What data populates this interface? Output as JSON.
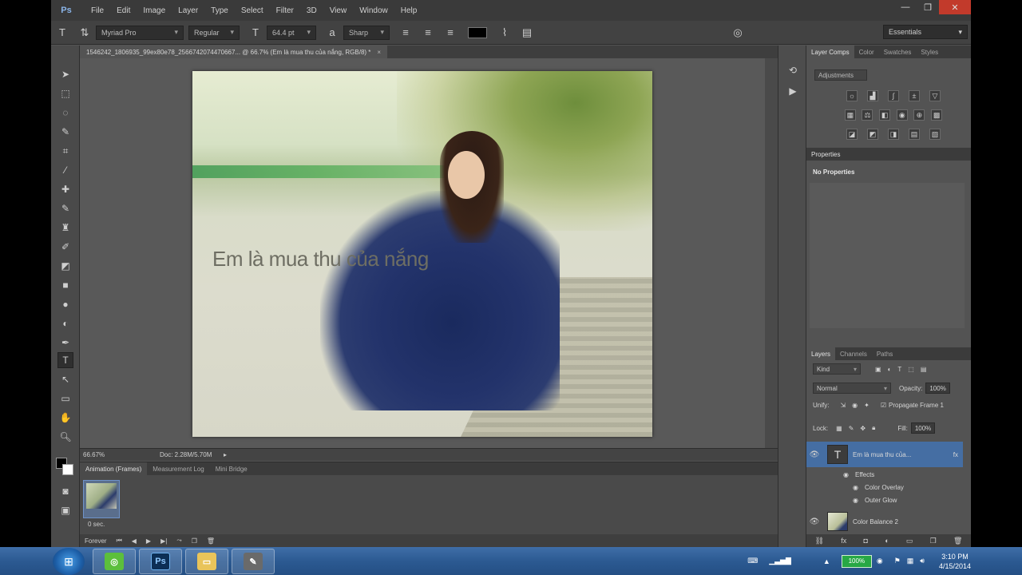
{
  "menubar": {
    "logo": "Ps",
    "items": [
      "File",
      "Edit",
      "Image",
      "Layer",
      "Type",
      "Select",
      "Filter",
      "3D",
      "View",
      "Window",
      "Help"
    ],
    "window_controls": [
      "—",
      "❐",
      "✕"
    ]
  },
  "options": {
    "font_family": "Myriad Pro",
    "font_style": "Regular",
    "font_size": "64.4 pt",
    "antialias": "Sharp",
    "workspace": "Essentials"
  },
  "document": {
    "tab_title": "1546242_1806935_99ex80e78_2566742074470667... @ 66.7% (Em là mua thu của nắng, RGB/8) *"
  },
  "canvas": {
    "caption": "Em là mua thu của nắng"
  },
  "status": {
    "zoom": "66.67%",
    "doc_size": "Doc: 2.28M/5.70M"
  },
  "animation": {
    "tabs": [
      "Animation (Frames)",
      "Measurement Log",
      "Mini Bridge"
    ],
    "frame_delay": "0 sec.",
    "loop": "Forever"
  },
  "panels": {
    "top_tabs": [
      "Layer Comps",
      "Color",
      "Swatches",
      "Styles"
    ],
    "adjustments_dropdown": "Adjustments",
    "properties_title": "Properties",
    "no_properties": "No Properties",
    "layers_tabs": [
      "Layers",
      "Channels",
      "Paths"
    ],
    "filter_kind": "Kind",
    "blend_mode": "Normal",
    "opacity_label": "Opacity:",
    "opacity_value": "100%",
    "unify_label": "Unify:",
    "propagate_label": "Propagate Frame 1",
    "lock_label": "Lock:",
    "fill_label": "Fill:",
    "fill_value": "100%",
    "layers": [
      {
        "name": "Em là mua thu của..."
      },
      {
        "name": "Effects"
      },
      {
        "name": "Color Overlay"
      },
      {
        "name": "Outer Glow"
      },
      {
        "name": "Color Balance 2"
      }
    ]
  },
  "taskbar": {
    "ps_label": "Ps",
    "battery": "100%",
    "time": "3:10 PM",
    "date": "4/15/2014"
  }
}
